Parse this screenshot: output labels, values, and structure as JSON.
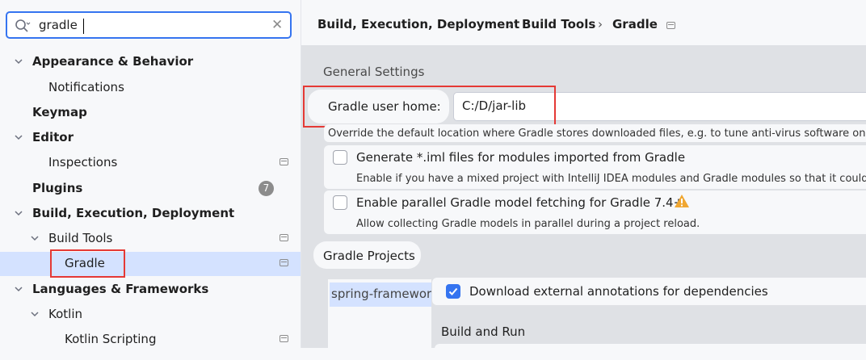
{
  "search": {
    "query": "gradle"
  },
  "tree": {
    "appearance": "Appearance & Behavior",
    "notifications": "Notifications",
    "keymap": "Keymap",
    "editor": "Editor",
    "inspections": "Inspections",
    "plugins": "Plugins",
    "plugins_badge": "7",
    "build": "Build, Execution, Deployment",
    "build_tools": "Build Tools",
    "gradle": "Gradle",
    "languages": "Languages & Frameworks",
    "kotlin": "Kotlin",
    "kotlin_scripting": "Kotlin Scripting"
  },
  "breadcrumb": {
    "part1": "Build, Execution, Deployment",
    "part2": "Build Tools",
    "part3": "Gradle",
    "sep": "›"
  },
  "general": {
    "title": "General Settings",
    "home_label": "Gradle user home:",
    "home_value": "C:/D/jar-lib",
    "home_hint": "Override the default location where Gradle stores downloaded files, e.g. to tune anti-virus software on Windo",
    "iml_label": "Generate *.iml files for modules imported from Gradle",
    "iml_hint": "Enable if you have a mixed project with IntelliJ IDEA modules and Gradle modules so that it could be sh",
    "parallel_label": "Enable parallel Gradle model fetching for Gradle 7.4+",
    "parallel_hint": "Allow collecting Gradle models in parallel during a project reload."
  },
  "projects": {
    "title": "Gradle Projects",
    "item": "spring-framework",
    "annotations_label": "Download external annotations for dependencies",
    "annotations_checked": true,
    "build_run_title": "Build and Run"
  },
  "colors": {
    "accent": "#3574f0",
    "selection": "#d4e2ff",
    "highlight": "#e53935",
    "warning": "#f0a732"
  }
}
